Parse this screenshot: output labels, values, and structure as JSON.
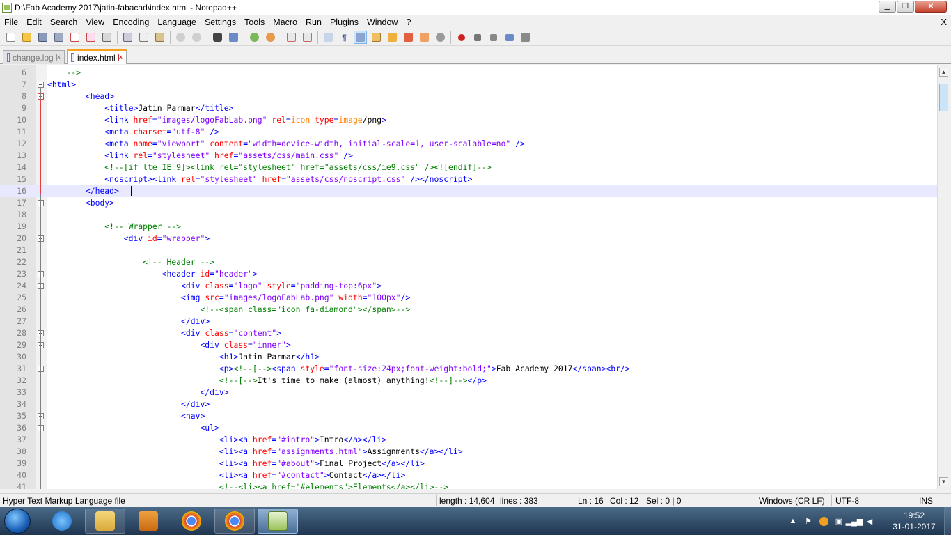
{
  "window": {
    "title": "D:\\Fab Academy 2017\\jatin-fabacad\\index.html - Notepad++"
  },
  "menu": [
    "File",
    "Edit",
    "Search",
    "View",
    "Encoding",
    "Language",
    "Settings",
    "Tools",
    "Macro",
    "Run",
    "Plugins",
    "Window",
    "?"
  ],
  "menu_close": "X",
  "tabs": [
    {
      "label": "change.log",
      "active": false
    },
    {
      "label": "index.html",
      "active": true
    }
  ],
  "editor": {
    "current_line": 16,
    "lines": [
      {
        "n": "6",
        "fold": "",
        "segs": [
          [
            "n",
            "    "
          ],
          [
            "c",
            "-->"
          ]
        ]
      },
      {
        "n": "7",
        "fold": "box",
        "segs": [
          [
            "t",
            "<html>"
          ]
        ]
      },
      {
        "n": "8",
        "fold": "red",
        "segs": [
          [
            "n",
            "        "
          ],
          [
            "t",
            "<head>"
          ]
        ]
      },
      {
        "n": "9",
        "fold": "",
        "segs": [
          [
            "n",
            "            "
          ],
          [
            "t",
            "<title>"
          ],
          [
            "n",
            "Jatin Parmar"
          ],
          [
            "t",
            "</title>"
          ]
        ]
      },
      {
        "n": "10",
        "fold": "",
        "segs": [
          [
            "n",
            "            "
          ],
          [
            "t",
            "<link "
          ],
          [
            "a",
            "href"
          ],
          [
            "t",
            "="
          ],
          [
            "v",
            "\"images/logoFabLab.png\""
          ],
          [
            "t",
            " "
          ],
          [
            "a",
            "rel"
          ],
          [
            "t",
            "="
          ],
          [
            "o",
            "icon"
          ],
          [
            "t",
            " "
          ],
          [
            "a",
            "type"
          ],
          [
            "t",
            "="
          ],
          [
            "o",
            "image"
          ],
          [
            "n",
            "/png"
          ],
          [
            "t",
            ">"
          ]
        ]
      },
      {
        "n": "11",
        "fold": "",
        "segs": [
          [
            "n",
            "            "
          ],
          [
            "t",
            "<meta "
          ],
          [
            "a",
            "charset"
          ],
          [
            "t",
            "="
          ],
          [
            "v",
            "\"utf-8\""
          ],
          [
            "t",
            " />"
          ]
        ]
      },
      {
        "n": "12",
        "fold": "",
        "segs": [
          [
            "n",
            "            "
          ],
          [
            "t",
            "<meta "
          ],
          [
            "a",
            "name"
          ],
          [
            "t",
            "="
          ],
          [
            "v",
            "\"viewport\""
          ],
          [
            "t",
            " "
          ],
          [
            "a",
            "content"
          ],
          [
            "t",
            "="
          ],
          [
            "v",
            "\"width=device-width, initial-scale=1, user-scalable=no\""
          ],
          [
            "t",
            " />"
          ]
        ]
      },
      {
        "n": "13",
        "fold": "",
        "segs": [
          [
            "n",
            "            "
          ],
          [
            "t",
            "<link "
          ],
          [
            "a",
            "rel"
          ],
          [
            "t",
            "="
          ],
          [
            "v",
            "\"stylesheet\""
          ],
          [
            "t",
            " "
          ],
          [
            "a",
            "href"
          ],
          [
            "t",
            "="
          ],
          [
            "v",
            "\"assets/css/main.css\""
          ],
          [
            "t",
            " />"
          ]
        ]
      },
      {
        "n": "14",
        "fold": "",
        "segs": [
          [
            "n",
            "            "
          ],
          [
            "c",
            "<!--[if lte IE 9]><link rel=\"stylesheet\" href=\"assets/css/ie9.css\" /><![endif]-->"
          ]
        ]
      },
      {
        "n": "15",
        "fold": "",
        "segs": [
          [
            "n",
            "            "
          ],
          [
            "t",
            "<noscript><link "
          ],
          [
            "a",
            "rel"
          ],
          [
            "t",
            "="
          ],
          [
            "v",
            "\"stylesheet\""
          ],
          [
            "t",
            " "
          ],
          [
            "a",
            "href"
          ],
          [
            "t",
            "="
          ],
          [
            "v",
            "\"assets/css/noscript.css\""
          ],
          [
            "t",
            " /></noscript>"
          ]
        ]
      },
      {
        "n": "16",
        "fold": "",
        "segs": [
          [
            "n",
            "        "
          ],
          [
            "t",
            "</head>"
          ]
        ]
      },
      {
        "n": "17",
        "fold": "box",
        "segs": [
          [
            "n",
            "        "
          ],
          [
            "t",
            "<body>"
          ]
        ]
      },
      {
        "n": "18",
        "fold": "",
        "segs": [
          [
            "n",
            ""
          ]
        ]
      },
      {
        "n": "19",
        "fold": "",
        "segs": [
          [
            "n",
            "            "
          ],
          [
            "c",
            "<!-- Wrapper -->"
          ]
        ]
      },
      {
        "n": "20",
        "fold": "box",
        "segs": [
          [
            "n",
            "                "
          ],
          [
            "t",
            "<div "
          ],
          [
            "a",
            "id"
          ],
          [
            "t",
            "="
          ],
          [
            "v",
            "\"wrapper\""
          ],
          [
            "t",
            ">"
          ]
        ]
      },
      {
        "n": "21",
        "fold": "",
        "segs": [
          [
            "n",
            ""
          ]
        ]
      },
      {
        "n": "22",
        "fold": "",
        "segs": [
          [
            "n",
            "                    "
          ],
          [
            "c",
            "<!-- Header -->"
          ]
        ]
      },
      {
        "n": "23",
        "fold": "box",
        "segs": [
          [
            "n",
            "                        "
          ],
          [
            "t",
            "<header "
          ],
          [
            "a",
            "id"
          ],
          [
            "t",
            "="
          ],
          [
            "v",
            "\"header\""
          ],
          [
            "t",
            ">"
          ]
        ]
      },
      {
        "n": "24",
        "fold": "box",
        "segs": [
          [
            "n",
            "                            "
          ],
          [
            "t",
            "<div "
          ],
          [
            "a",
            "class"
          ],
          [
            "t",
            "="
          ],
          [
            "v",
            "\"logo\""
          ],
          [
            "t",
            " "
          ],
          [
            "a",
            "style"
          ],
          [
            "t",
            "="
          ],
          [
            "v",
            "\"padding-top:6px\""
          ],
          [
            "t",
            ">"
          ]
        ]
      },
      {
        "n": "25",
        "fold": "",
        "segs": [
          [
            "n",
            "                            "
          ],
          [
            "t",
            "<img "
          ],
          [
            "a",
            "src"
          ],
          [
            "t",
            "="
          ],
          [
            "v",
            "\"images/logoFabLab.png\""
          ],
          [
            "t",
            " "
          ],
          [
            "a",
            "width"
          ],
          [
            "t",
            "="
          ],
          [
            "v",
            "\"100px\""
          ],
          [
            "t",
            "/>"
          ]
        ]
      },
      {
        "n": "26",
        "fold": "",
        "segs": [
          [
            "n",
            "                                "
          ],
          [
            "c",
            "<!--<span class=\"icon fa-diamond\"></span>-->"
          ]
        ]
      },
      {
        "n": "27",
        "fold": "",
        "segs": [
          [
            "n",
            "                            "
          ],
          [
            "t",
            "</div>"
          ]
        ]
      },
      {
        "n": "28",
        "fold": "box",
        "segs": [
          [
            "n",
            "                            "
          ],
          [
            "t",
            "<div "
          ],
          [
            "a",
            "class"
          ],
          [
            "t",
            "="
          ],
          [
            "v",
            "\"content\""
          ],
          [
            "t",
            ">"
          ]
        ]
      },
      {
        "n": "29",
        "fold": "box",
        "segs": [
          [
            "n",
            "                                "
          ],
          [
            "t",
            "<div "
          ],
          [
            "a",
            "class"
          ],
          [
            "t",
            "="
          ],
          [
            "v",
            "\"inner\""
          ],
          [
            "t",
            ">"
          ]
        ]
      },
      {
        "n": "30",
        "fold": "",
        "segs": [
          [
            "n",
            "                                    "
          ],
          [
            "t",
            "<h1>"
          ],
          [
            "n",
            "Jatin Parmar"
          ],
          [
            "t",
            "</h1>"
          ]
        ]
      },
      {
        "n": "31",
        "fold": "box",
        "segs": [
          [
            "n",
            "                                    "
          ],
          [
            "t",
            "<p>"
          ],
          [
            "c",
            "<!--[-->"
          ],
          [
            "t",
            "<span "
          ],
          [
            "a",
            "style"
          ],
          [
            "t",
            "="
          ],
          [
            "v",
            "\"font-size:24px;font-weight:bold;\""
          ],
          [
            "t",
            ">"
          ],
          [
            "n",
            "Fab Academy 2017"
          ],
          [
            "t",
            "</span><br/>"
          ]
        ]
      },
      {
        "n": "32",
        "fold": "",
        "segs": [
          [
            "n",
            "                                    "
          ],
          [
            "c",
            "<!--[-->"
          ],
          [
            "n",
            "It's time to make (almost) anything!"
          ],
          [
            "c",
            "<!--]-->"
          ],
          [
            "t",
            "</p>"
          ]
        ]
      },
      {
        "n": "33",
        "fold": "",
        "segs": [
          [
            "n",
            "                                "
          ],
          [
            "t",
            "</div>"
          ]
        ]
      },
      {
        "n": "34",
        "fold": "",
        "segs": [
          [
            "n",
            "                            "
          ],
          [
            "t",
            "</div>"
          ]
        ]
      },
      {
        "n": "35",
        "fold": "box",
        "segs": [
          [
            "n",
            "                            "
          ],
          [
            "t",
            "<nav>"
          ]
        ]
      },
      {
        "n": "36",
        "fold": "box",
        "segs": [
          [
            "n",
            "                                "
          ],
          [
            "t",
            "<ul>"
          ]
        ]
      },
      {
        "n": "37",
        "fold": "",
        "segs": [
          [
            "n",
            "                                    "
          ],
          [
            "t",
            "<li><a "
          ],
          [
            "a",
            "href"
          ],
          [
            "t",
            "="
          ],
          [
            "v",
            "\"#intro\""
          ],
          [
            "t",
            ">"
          ],
          [
            "n",
            "Intro"
          ],
          [
            "t",
            "</a></li>"
          ]
        ]
      },
      {
        "n": "38",
        "fold": "",
        "segs": [
          [
            "n",
            "                                    "
          ],
          [
            "t",
            "<li><a "
          ],
          [
            "a",
            "href"
          ],
          [
            "t",
            "="
          ],
          [
            "v",
            "\"assignments.html\""
          ],
          [
            "t",
            ">"
          ],
          [
            "n",
            "Assignments"
          ],
          [
            "t",
            "</a></li>"
          ]
        ]
      },
      {
        "n": "39",
        "fold": "",
        "segs": [
          [
            "n",
            "                                    "
          ],
          [
            "t",
            "<li><a "
          ],
          [
            "a",
            "href"
          ],
          [
            "t",
            "="
          ],
          [
            "v",
            "\"#about\""
          ],
          [
            "t",
            ">"
          ],
          [
            "n",
            "Final Project"
          ],
          [
            "t",
            "</a></li>"
          ]
        ]
      },
      {
        "n": "40",
        "fold": "",
        "segs": [
          [
            "n",
            "                                    "
          ],
          [
            "t",
            "<li><a "
          ],
          [
            "a",
            "href"
          ],
          [
            "t",
            "="
          ],
          [
            "v",
            "\"#contact\""
          ],
          [
            "t",
            ">"
          ],
          [
            "n",
            "Contact"
          ],
          [
            "t",
            "</a></li>"
          ]
        ]
      },
      {
        "n": "41",
        "fold": "",
        "segs": [
          [
            "n",
            "                                    "
          ],
          [
            "c",
            "<!--<li><a href=\"#elements\">Elements</a></li>-->"
          ]
        ]
      }
    ]
  },
  "status": {
    "filetype": "Hyper Text Markup Language file",
    "length": "length : 14,604",
    "lines": "lines : 383",
    "ln": "Ln : 16",
    "col": "Col : 12",
    "sel": "Sel : 0 | 0",
    "eol": "Windows (CR LF)",
    "encoding": "UTF-8",
    "mode": "INS"
  },
  "clock": {
    "time": "19:52",
    "date": "31-01-2017"
  },
  "colors": {
    "tag": "#0000ff",
    "attr": "#ff0000",
    "value": "#8000ff",
    "comment": "#008000",
    "accent": "#f9a01a"
  }
}
